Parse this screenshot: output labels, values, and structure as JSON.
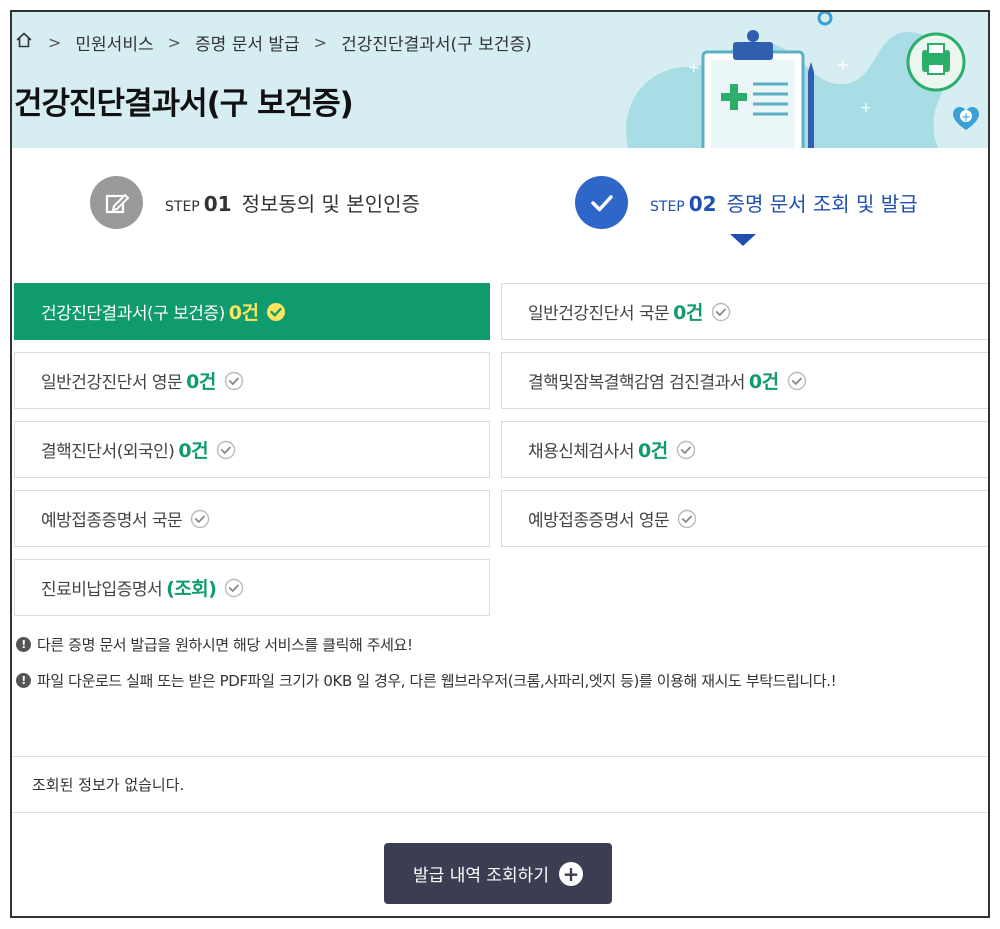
{
  "breadcrumb": {
    "home_icon": "home-icon",
    "items": [
      "민원서비스",
      "증명 문서 발급",
      "건강진단결과서(구 보건증)"
    ]
  },
  "page_title": "건강진단결과서(구 보건증)",
  "steps": [
    {
      "prefix": "STEP",
      "number": "01",
      "label": "정보동의 및 본인인증",
      "icon": "edit-icon",
      "state": "done"
    },
    {
      "prefix": "STEP",
      "number": "02",
      "label": "증명 문서 조회 및 발급",
      "icon": "check-icon",
      "state": "current"
    }
  ],
  "documents": [
    {
      "label": "건강진단결과서(구 보건증)",
      "count": "0건",
      "active": true
    },
    {
      "label": "일반건강진단서 국문",
      "count": "0건",
      "active": false
    },
    {
      "label": "일반건강진단서 영문",
      "count": "0건",
      "active": false
    },
    {
      "label": "결핵및잠복결핵감염 검진결과서",
      "count": "0건",
      "active": false
    },
    {
      "label": "결핵진단서(외국인)",
      "count": "0건",
      "active": false
    },
    {
      "label": "채용신체검사서",
      "count": "0건",
      "active": false
    },
    {
      "label": "예방접종증명서 국문",
      "count": "",
      "active": false
    },
    {
      "label": "예방접종증명서 영문",
      "count": "",
      "active": false
    },
    {
      "label": "진료비납입증명서",
      "count": "(조회)",
      "active": false
    }
  ],
  "notices": [
    "다른 증명 문서 발급을 원하시면 해당 서비스를 클릭해 주세요!",
    "파일 다운로드 실패 또는 받은 PDF파일 크기가 0KB 일 경우, 다른 웹브라우저(크롬,사파리,엣지 등)를 이용해 재시도 부탁드립니다.!"
  ],
  "result_message": "조회된 정보가 없습니다.",
  "history_button": "발급 내역 조회하기",
  "colors": {
    "accent_green": "#0f9b6e",
    "step_blue": "#2f67c8",
    "count_highlight": "#ffe45c",
    "button_dark": "#3b3e52",
    "header_bg": "#d6eef2"
  }
}
